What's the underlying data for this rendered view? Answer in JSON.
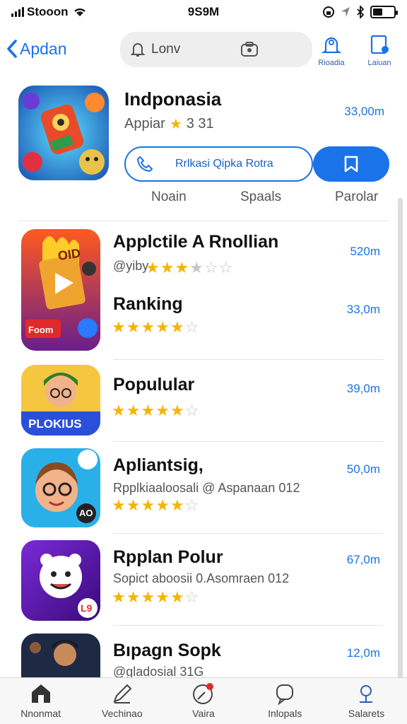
{
  "status": {
    "carrier": "Stooon",
    "time": "9S9M"
  },
  "nav": {
    "back_label": "Apdan",
    "search_text": "Lonv",
    "action1_label": "Rioadia",
    "action2_label": "Laiuan"
  },
  "featured": {
    "title": "Indponasia",
    "rating_prefix": "Appiar",
    "rating_value": "3 31",
    "size": "33,00m",
    "button_label": "Rrlkasi Qipka Rotra"
  },
  "tabs": [
    "Noain",
    "Spaals",
    "Parolar"
  ],
  "apps": [
    {
      "title": "Applctile A Rnollian",
      "sub": "@yiby",
      "stars": [
        1,
        1,
        1,
        0,
        0,
        0
      ],
      "size": "520m",
      "icon_text": "OID",
      "icon_caption": "Foom"
    },
    {
      "title": "Ranking",
      "sub": "",
      "stars": [
        1,
        1,
        1,
        1,
        1,
        0
      ],
      "size": "33,0m"
    },
    {
      "title": "Populular",
      "sub": "",
      "stars": [
        1,
        1,
        1,
        1,
        1,
        0
      ],
      "size": "39,0m",
      "icon_text": "PLOKIUS"
    },
    {
      "title": "Apliantsig,",
      "sub": "Rpplkiaaloosali @ Aspanaan 012",
      "stars": [
        1,
        1,
        1,
        1,
        1,
        0
      ],
      "size": "50,0m",
      "icon_text": "AO"
    },
    {
      "title": "Rpplan Polur",
      "sub": "Sopict aboosii 0.Asomraen 012",
      "stars": [
        1,
        1,
        1,
        1,
        1,
        0
      ],
      "size": "67,0m",
      "icon_text": "L9"
    },
    {
      "title": "Bıpagn Sopk",
      "sub": "@gladosial 31G",
      "stars": [],
      "size": "12,0m"
    }
  ],
  "tabbar": [
    "Nnonmat",
    "Vechinao",
    "Vaira",
    "Inlopals",
    "Salarets"
  ],
  "colors": {
    "accent": "#1a73e8",
    "star": "#f5b400"
  }
}
